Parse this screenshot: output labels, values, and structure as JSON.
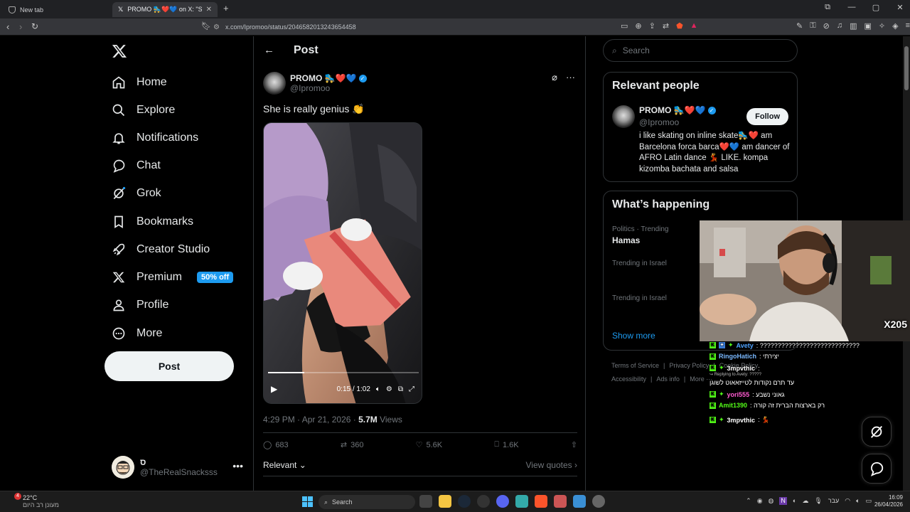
{
  "browser": {
    "tabs": [
      {
        "label": "New tab",
        "active": false
      },
      {
        "label": "PROMO 🛼❤️💙 on X: \"She is r",
        "active": true
      }
    ],
    "url": "x.com/Ipromoo/status/2046582013243654458"
  },
  "nav": {
    "items": [
      {
        "label": "Home",
        "icon": "home-icon"
      },
      {
        "label": "Explore",
        "icon": "search-icon"
      },
      {
        "label": "Notifications",
        "icon": "bell-icon"
      },
      {
        "label": "Chat",
        "icon": "chat-bubble-icon"
      },
      {
        "label": "Grok",
        "icon": "grok-icon"
      },
      {
        "label": "Bookmarks",
        "icon": "bookmark-icon"
      },
      {
        "label": "Creator Studio",
        "icon": "rocket-icon"
      },
      {
        "label": "Premium",
        "icon": "x-icon"
      },
      {
        "label": "Profile",
        "icon": "person-icon"
      },
      {
        "label": "More",
        "icon": "more-circle-icon"
      }
    ],
    "premium_badge": "50% off",
    "post_button": "Post",
    "account": {
      "name": "ס",
      "handle": "@TheRealSnacksss"
    }
  },
  "header": {
    "title": "Post"
  },
  "post": {
    "author_name": "PROMO 🛼❤️💙",
    "author_handle": "@Ipromoo",
    "text": "She is really  genius 👏",
    "video": {
      "time": "0:15 / 1:02",
      "progress": 0.24
    },
    "timestamp": "4:29 PM · Apr 21, 2026 · ",
    "views_count": "5.7M",
    "views_label": " Views",
    "replies": "683",
    "reposts": "360",
    "likes": "5.6K",
    "bookmarks": "1.6K",
    "sort_label": "Relevant",
    "view_quotes": "View quotes"
  },
  "sidebar": {
    "search_placeholder": "Search",
    "relevant_title": "Relevant people",
    "person": {
      "name": "PROMO 🛼❤️💙",
      "handle": "@Ipromoo",
      "follow": "Follow",
      "bio": "i like skating on inline skate🛼❤️ am Barcelona forca barca❤️💙 am dancer of AFRO Latin dance 💃 LIKE. kompa kizomba bachata and salsa"
    },
    "happening_title": "What’s happening",
    "trends": [
      {
        "context": "Politics · Trending",
        "name": "Hamas"
      },
      {
        "context": "Trending in Israel",
        "name": ""
      },
      {
        "context": "Trending in Israel",
        "name": ""
      }
    ],
    "show_more": "Show more",
    "footer": [
      "Terms of Service",
      "|",
      "Privacy Policy",
      "|",
      "Cookie Policy",
      "Accessibility",
      "|",
      "Ads info",
      "|",
      "More ···"
    ]
  },
  "overlay": {
    "webcam_badge": "X205",
    "chat": [
      {
        "user": "Avety",
        "user_color": "#4fa3ff",
        "msg": ": ????????????????????????????"
      },
      {
        "user": "RingoHatich",
        "user_color": "#7ab8ff",
        "msg": ": יצירתי"
      },
      {
        "user": "3mpvthic",
        "user_color": "#ffffff",
        "msg": ":"
      },
      {
        "user": "",
        "user_color": "#ffffff",
        "msg": "עד תרם נקודות לטייזאאוט לשוגן"
      },
      {
        "user": "yori555",
        "user_color": "#ff5bd1",
        "msg": ": גאוני נשבע"
      },
      {
        "user": "Amit1390",
        "user_color": "#53fc18",
        "msg": ": רק בארצות הברית זה קורה"
      },
      {
        "user": "3mpvthic",
        "user_color": "#ffffff",
        "msg": ": 💃"
      }
    ],
    "reply_note": "↪ Replying to Avety: ?????"
  },
  "taskbar": {
    "temp": "22°C",
    "weather_text": "מעונן רב היום",
    "search": "Search",
    "lang": "עבר",
    "time": "16:09",
    "date": "26/04/2026",
    "weather_badge": "4"
  }
}
